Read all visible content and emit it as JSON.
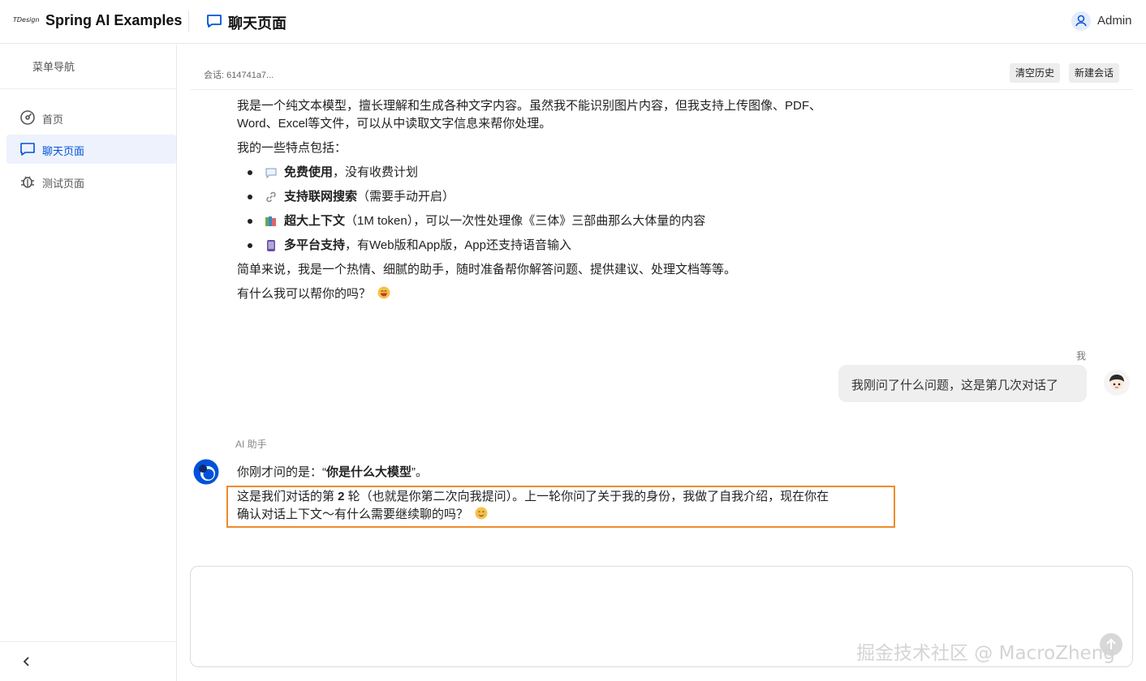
{
  "header": {
    "logo_text": "TDesign",
    "app_title": "Spring AI Examples",
    "page_title": "聊天页面",
    "user_name": "Admin"
  },
  "sidebar": {
    "heading": "菜单导航",
    "items": [
      {
        "label": "首页",
        "icon": "dashboard-icon"
      },
      {
        "label": "聊天页面",
        "icon": "chat-icon",
        "active": true
      },
      {
        "label": "测试页面",
        "icon": "bug-icon"
      }
    ]
  },
  "session": {
    "label": "会话: 614741a7...",
    "clear_history": "清空历史",
    "new_session": "新建会话"
  },
  "first_reply": {
    "intro_line1": "我是一个纯文本模型，擅长理解和生成各种文字内容。虽然我不能识别图片内容，但我支持上传图像、PDF、",
    "intro_line2": "Word、Excel等文件，可以从中读取文字信息来帮你处理。",
    "features_heading": "我的一些特点包括：",
    "features": [
      {
        "icon": "speech-bubble-icon",
        "bold": "免费使用",
        "rest": "，没有收费计划"
      },
      {
        "icon": "link-icon",
        "bold": "支持联网搜索",
        "rest": "（需要手动开启）"
      },
      {
        "icon": "books-icon",
        "bold": "超大上下文",
        "rest": "（1M token），可以一次性处理像《三体》三部曲那么大体量的内容"
      },
      {
        "icon": "phone-icon",
        "bold": "多平台支持",
        "rest": "，有Web版和App版，App还支持语音输入"
      }
    ],
    "summary": "简单来说，我是一个热情、细腻的助手，随时准备帮你解答问题、提供建议、处理文档等等。",
    "closing": "有什么我可以帮你的吗？"
  },
  "user_message": {
    "label": "我",
    "text": "我刚问了什么问题，这是第几次对话了"
  },
  "ai_reply": {
    "label": "AI 助手",
    "line1_prefix": "你刚才问的是：“",
    "line1_bold": "你是什么大模型",
    "line1_suffix": "”。",
    "line2_prefix": "这是我们对话的第 ",
    "line2_bold": "2",
    "line2_suffix": " 轮（也就是你第二次向我提问）。上一轮你问了关于我的身份，我做了自我介绍，现在你在",
    "line3": "确认对话上下文～有什么需要继续聊的吗？"
  },
  "watermark": "掘金技术社区 @ MacroZheng",
  "colors": {
    "brand": "#0052d9",
    "highlight_border": "#ef8a2c",
    "active_nav_bg": "#eef2fd"
  }
}
